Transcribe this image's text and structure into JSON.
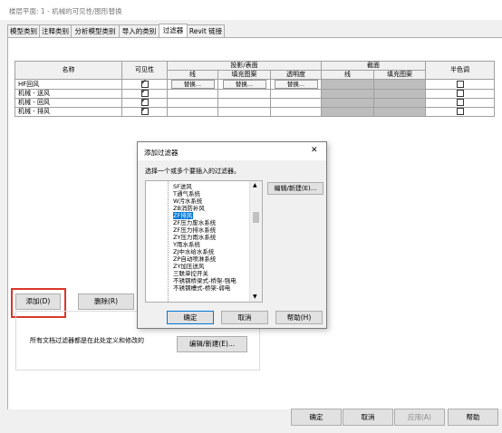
{
  "window": {
    "title": "楼层平面: 1 - 机械的可见性/图形替换"
  },
  "tabs": [
    "模型类别",
    "注释类别",
    "分析模型类别",
    "导入的类别",
    "过滤器",
    "Revit 链接"
  ],
  "table": {
    "headers": {
      "name": "名称",
      "visibility": "可见性",
      "projection": "投影/表面",
      "cut": "截面",
      "halftone": "半色调",
      "line": "线",
      "fill": "填充图案",
      "transparency": "透明度"
    },
    "override_label": "替换...",
    "rows": [
      {
        "name": "HF回风",
        "visible": true,
        "halftone": false
      },
      {
        "name": "机械 - 送风",
        "visible": true,
        "halftone": false
      },
      {
        "name": "机械 - 回风",
        "visible": true,
        "halftone": false
      },
      {
        "name": "机械 - 排风",
        "visible": true,
        "halftone": false
      }
    ]
  },
  "buttons": {
    "add": "添加(D)",
    "delete": "删除(R)",
    "edit_new": "编辑/新建(E)...",
    "ok": "确定",
    "cancel": "取消",
    "apply": "应用(A)",
    "help": "帮助"
  },
  "info_text": "所有文档过滤器都是在此处定义和修改的",
  "dialog": {
    "title": "添加过滤器",
    "close": "✕",
    "prompt": "选择一个或多个要插入的过滤器。",
    "edit_new": "编辑/新建(E)...",
    "items": [
      "SF送风",
      "T通气系统",
      "W污水系统",
      "ZB消防补风",
      "ZF排风",
      "ZF压力废水系统",
      "ZF压力排水系统",
      "ZY压力雨水系统",
      "Y雨水系统",
      "ZJ中水给水系统",
      "ZP自动喷淋系统",
      "ZY加压送风",
      "三联单控开关",
      "不锈钢桥梁式-桥架-强电",
      "不锈钢槽式-桥架-弱电"
    ],
    "selected_index": 4,
    "ok": "确定",
    "cancel": "取消",
    "help": "帮助(H)"
  }
}
